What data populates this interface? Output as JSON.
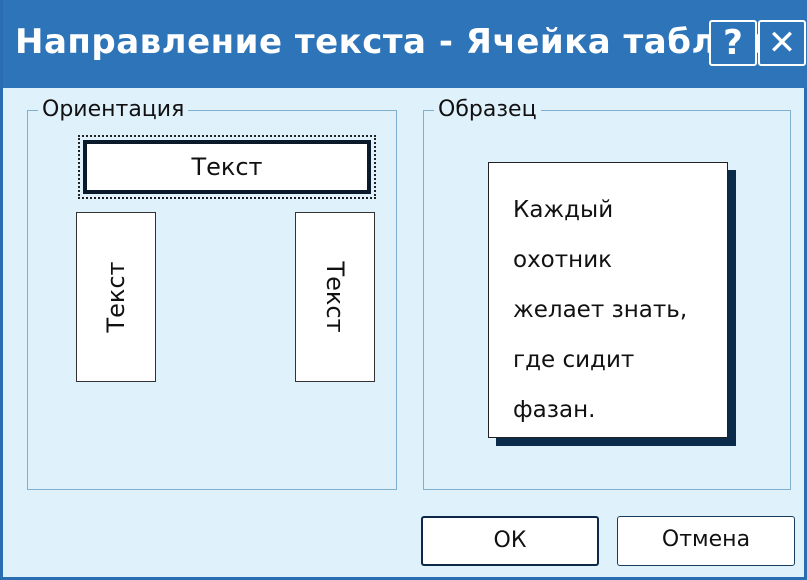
{
  "window": {
    "title": "Направление текста - Ячейка таблицы",
    "help_label": "?",
    "close_label": "✕"
  },
  "orientation": {
    "legend": "Ориентация",
    "options": [
      {
        "label": "Текст",
        "direction": "horizontal",
        "selected": true
      },
      {
        "label": "Текст",
        "direction": "vertical-up",
        "selected": false
      },
      {
        "label": "Текст",
        "direction": "vertical-down",
        "selected": false
      }
    ]
  },
  "sample": {
    "legend": "Образец",
    "lines": [
      "Каждый",
      "охотник",
      "желает знать,",
      "где сидит",
      "фазан."
    ]
  },
  "buttons": {
    "ok": "ОК",
    "cancel": "Отмена"
  }
}
